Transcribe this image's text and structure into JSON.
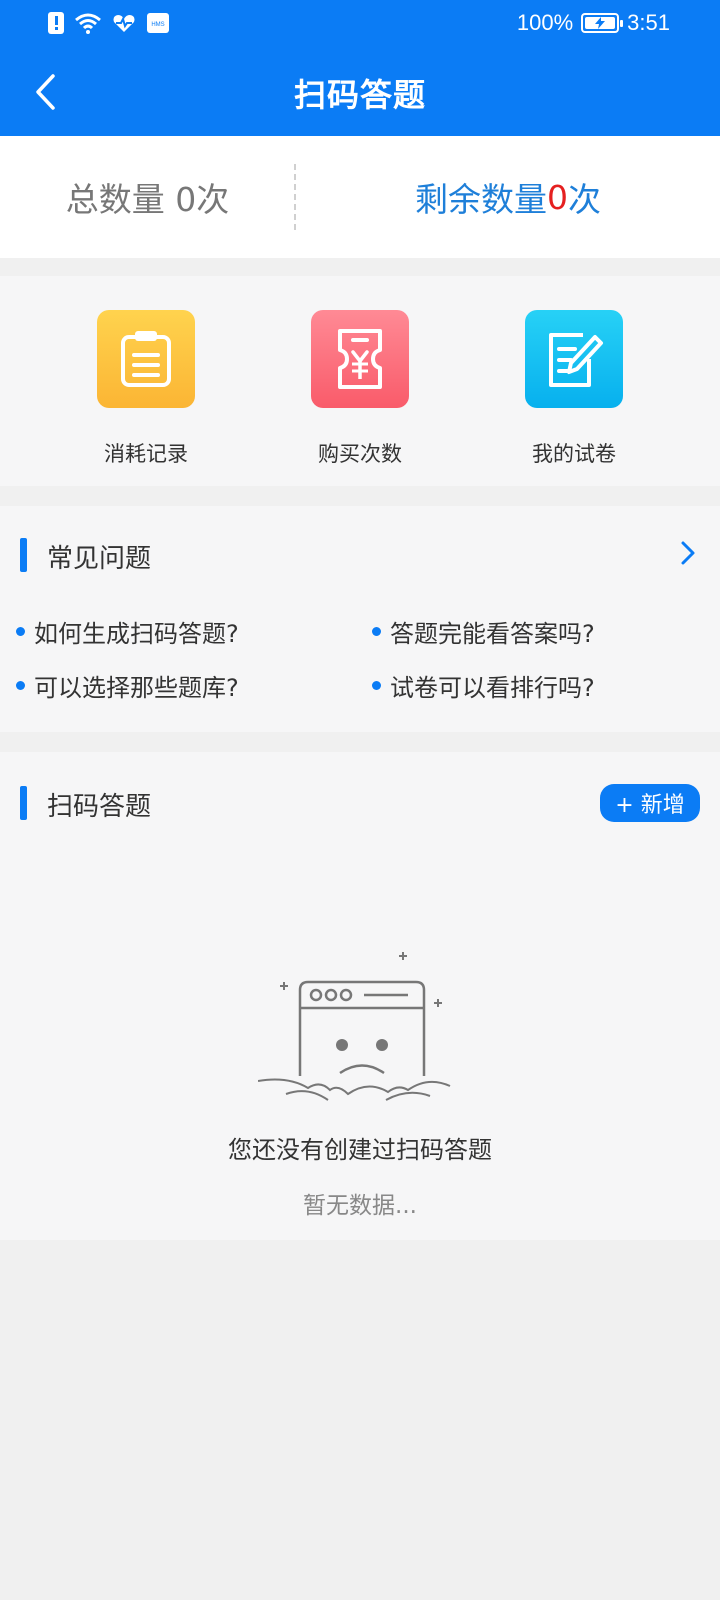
{
  "status_bar": {
    "battery_pct": "100%",
    "time": "3:51"
  },
  "header": {
    "title": "扫码答题"
  },
  "counts": {
    "total_text": "总数量 0次",
    "remaining_label": "剩余数量",
    "remaining_value": "0",
    "remaining_unit": "次"
  },
  "quick_actions": [
    {
      "label": "消耗记录",
      "icon": "clipboard-icon"
    },
    {
      "label": "购买次数",
      "icon": "ticket-yen-icon"
    },
    {
      "label": "我的试卷",
      "icon": "edit-paper-icon"
    }
  ],
  "faq": {
    "title": "常见问题",
    "items": [
      "如何生成扫码答题?",
      "答题完能看答案吗?",
      "可以选择那些题库?",
      "试卷可以看排行吗?"
    ]
  },
  "scan_section": {
    "title": "扫码答题",
    "add_label": "+ 新增",
    "empty_title": "您还没有创建过扫码答题",
    "empty_sub": "暂无数据..."
  },
  "colors": {
    "primary": "#0b7cf5",
    "accent_red": "#e52020",
    "count_blue": "#1e7fd9"
  }
}
